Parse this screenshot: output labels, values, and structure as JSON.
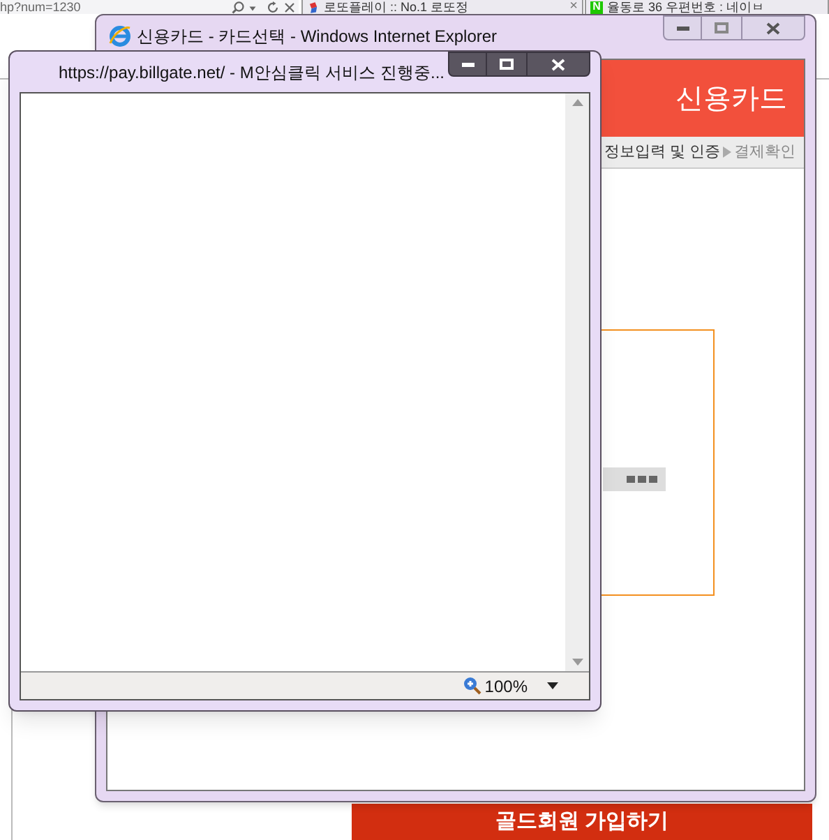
{
  "background_browser": {
    "address": "hp?num=1230",
    "tabs": [
      {
        "title": "로또플레이 :: No.1 로또정",
        "close": "×"
      },
      {
        "title": "율동로 36 우편번호 : 네이ㅂ",
        "logo": "N"
      }
    ],
    "join_button": "골드회원 가입하기"
  },
  "ie_window": {
    "title": "신용카드 - 카드선택 - Windows Internet Explorer",
    "header": "신용카드",
    "steps": [
      "정보입력 및 인증",
      "결제확인"
    ]
  },
  "popup_window": {
    "title": "https://pay.billgate.net/ - M안심클릭 서비스 진행중...",
    "zoom": "100%"
  }
}
